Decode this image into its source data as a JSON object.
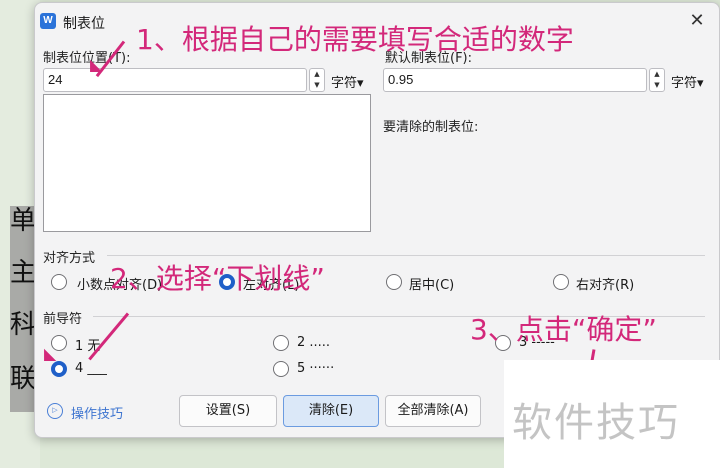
{
  "document": {
    "chars": [
      "单",
      "主",
      "科",
      "联"
    ]
  },
  "dialog": {
    "app_icon": "W",
    "title": "制表位",
    "close_glyph": "✕"
  },
  "tab_position": {
    "label": "制表位位置(T):",
    "value": "24",
    "unit": "字符▾"
  },
  "default_tab": {
    "label": "默认制表位(F):",
    "value": "0.95",
    "unit": "字符▾"
  },
  "clear_label": "要清除的制表位:",
  "alignment": {
    "label": "对齐方式",
    "options": [
      {
        "label": "小数点对齐(D)",
        "checked": false
      },
      {
        "label": "左对齐(L)",
        "checked": true
      },
      {
        "label": "居中(C)",
        "checked": false
      },
      {
        "label": "右对齐(R)",
        "checked": false
      }
    ]
  },
  "leader": {
    "label": "前导符",
    "options": [
      {
        "label": "1 无",
        "checked": false
      },
      {
        "label": "2 .....",
        "checked": false
      },
      {
        "label": "3 -----",
        "checked": false
      },
      {
        "label": "4 ___",
        "checked": true
      },
      {
        "label": "5 ······",
        "checked": false
      }
    ]
  },
  "help": {
    "icon": "▷",
    "label": "操作技巧"
  },
  "buttons": {
    "set": "设置(S)",
    "clear": "清除(E)",
    "clear_all": "全部清除(A)"
  },
  "annotations": {
    "step1": "1、根据自己的需要填写合适的数字",
    "step2": "2、选择“下划线”",
    "step3": "3、点击“确定”"
  },
  "watermark": "软件技巧",
  "colors": {
    "annotation": "#d3287a",
    "radio_checked": "#1f5fc8",
    "link": "#3d74d0"
  }
}
